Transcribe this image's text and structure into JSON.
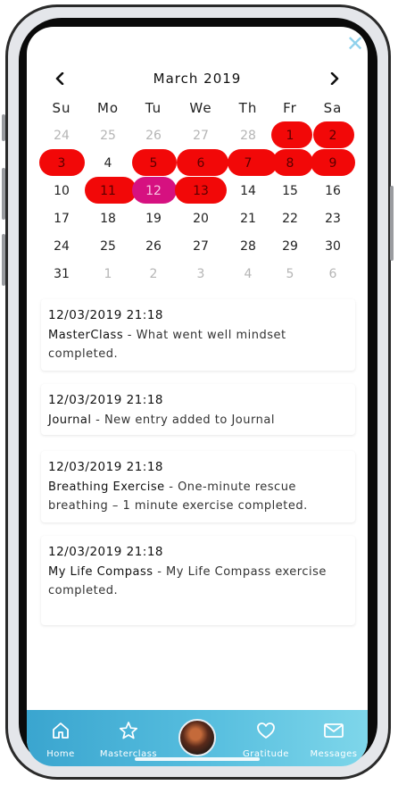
{
  "calendar": {
    "month_label": "March 2019",
    "weekdays": [
      "Su",
      "Mo",
      "Tu",
      "We",
      "Th",
      "Fr",
      "Sa"
    ],
    "weeks": [
      [
        "24",
        "25",
        "26",
        "27",
        "28",
        "1",
        "2"
      ],
      [
        "3",
        "4",
        "5",
        "6",
        "7",
        "8",
        "9"
      ],
      [
        "10",
        "11",
        "12",
        "13",
        "14",
        "15",
        "16"
      ],
      [
        "17",
        "18",
        "19",
        "20",
        "21",
        "22",
        "23"
      ],
      [
        "24",
        "25",
        "26",
        "27",
        "28",
        "29",
        "30"
      ],
      [
        "31",
        "1",
        "2",
        "3",
        "4",
        "5",
        "6"
      ]
    ],
    "highlight_color": "#f20808",
    "today_color": "#d61180",
    "today": "12"
  },
  "activity": [
    {
      "timestamp": "12/03/2019 21:18",
      "title": "MasterClass",
      "description": "What went well mindset completed."
    },
    {
      "timestamp": "12/03/2019 21:18",
      "title": "Journal",
      "description": "New entry added to Journal"
    },
    {
      "timestamp": "12/03/2019 21:18",
      "title": "Breathing Exercise",
      "description": "One-minute rescue breathing – 1 minute exercise completed."
    },
    {
      "timestamp": "12/03/2019 21:18",
      "title": "My Life Compass",
      "description": "My Life Compass exercise completed."
    }
  ],
  "tabbar": {
    "home": {
      "label": "Home",
      "icon": "home-icon"
    },
    "masterclass": {
      "label": "Masterclass",
      "icon": "star-icon"
    },
    "profile": {
      "icon": "profile-avatar"
    },
    "gratitude": {
      "label": "Gratitude",
      "icon": "heart-icon"
    },
    "messages": {
      "label": "Messages",
      "icon": "mail-icon"
    }
  },
  "icons": {
    "close": "✕",
    "prev": "‹",
    "next": "›"
  }
}
